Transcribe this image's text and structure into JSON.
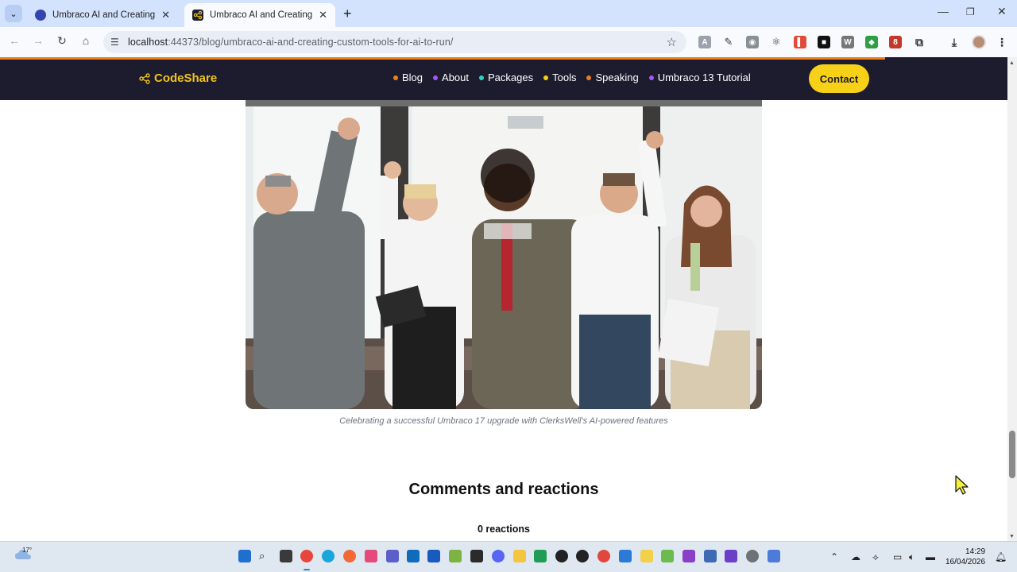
{
  "browser": {
    "tabs": [
      {
        "title": "Umbraco AI and Creating Custo",
        "active": false
      },
      {
        "title": "Umbraco AI and Creating Custo",
        "active": true
      }
    ],
    "url_host": "localhost",
    "url_rest": ":44373/blog/umbraco-ai-and-creating-custom-tools-for-ai-to-run/",
    "extension_badge": "8"
  },
  "site": {
    "logo": "CodeShare",
    "nav": [
      {
        "label": "Blog",
        "color": "#f07d1c"
      },
      {
        "label": "About",
        "color": "#a855f7"
      },
      {
        "label": "Packages",
        "color": "#2dd4bf"
      },
      {
        "label": "Tools",
        "color": "#f7d117"
      },
      {
        "label": "Speaking",
        "color": "#f07d1c"
      },
      {
        "label": "Umbraco 13 Tutorial",
        "color": "#a855f7"
      }
    ],
    "contact_label": "Contact",
    "accent": "#f7d117",
    "header_bg": "#1c1c2e"
  },
  "article": {
    "image_caption": "Celebrating a successful Umbraco 17 upgrade with ClerksWell's AI-powered features",
    "comments_heading": "Comments and reactions",
    "reactions_count": "0 reactions"
  },
  "taskbar": {
    "weather_temp": "17°",
    "time": "14:29",
    "date": "16/04/2026"
  }
}
